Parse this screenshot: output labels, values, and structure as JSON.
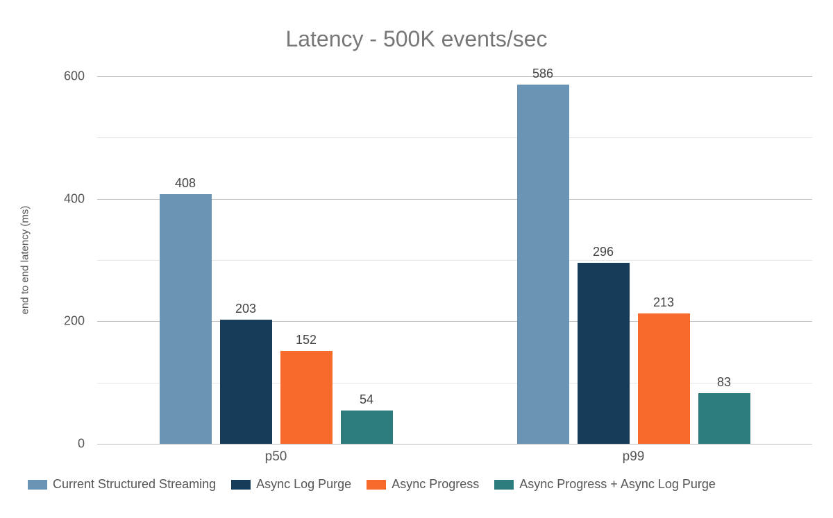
{
  "chart_data": {
    "type": "bar",
    "title": "Latency - 500K events/sec",
    "xlabel": "",
    "ylabel": "end to end latency (ms)",
    "categories": [
      "p50",
      "p99"
    ],
    "series": [
      {
        "name": "Current Structured Streaming",
        "color": "#6a94b5",
        "values": [
          408,
          586
        ]
      },
      {
        "name": "Async Log Purge",
        "color": "#163c5a",
        "values": [
          203,
          296
        ]
      },
      {
        "name": "Async Progress",
        "color": "#f76a2b",
        "values": [
          152,
          213
        ]
      },
      {
        "name": "Async Progress + Async Log Purge",
        "color": "#2c7b7d",
        "values": [
          54,
          83
        ]
      }
    ],
    "ylim": [
      0,
      600
    ],
    "yticks": [
      0,
      200,
      400,
      600
    ]
  }
}
